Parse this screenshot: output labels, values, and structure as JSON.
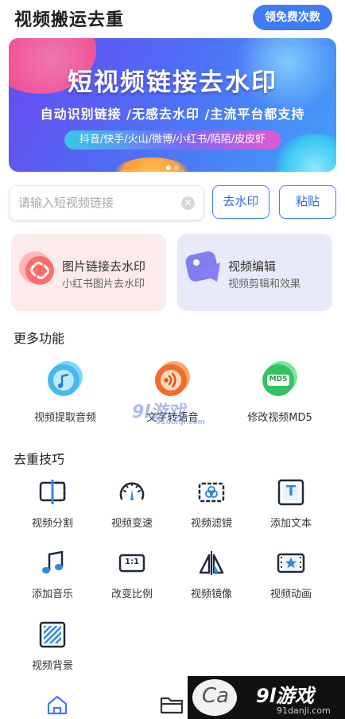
{
  "header": {
    "title": "视频搬运去重",
    "free_button": "领免费次数"
  },
  "banner": {
    "title": "短视频链接去水印",
    "subtitle": "自动识别链接 /无感去水印 /主流平台都支持",
    "platforms": "抖音/快手/火山/微博/小红书/陌陌/皮皮虾",
    "slide_count": 2,
    "active_slide": 1
  },
  "search": {
    "placeholder": "请输入短视频链接",
    "value": ""
  },
  "actions": {
    "remove_watermark": "去水印",
    "paste": "粘贴"
  },
  "cards": [
    {
      "title": "图片链接去水印",
      "subtitle": "小红书图片去水印",
      "icon": "link-icon",
      "color": "#fdeaea"
    },
    {
      "title": "视频编辑",
      "subtitle": "视频剪辑和效果",
      "icon": "video-edit-icon",
      "color": "#e9eaf9"
    }
  ],
  "more_section": {
    "title": "更多功能",
    "items": [
      {
        "label": "视频提取音频",
        "icon": "music-note-icon",
        "color": "#4fc2ef"
      },
      {
        "label": "文字转语音",
        "icon": "sound-wave-icon",
        "color": "#f7743a"
      },
      {
        "label": "修改视频MD5",
        "icon": "md5-icon",
        "color": "#33c86a",
        "badge": "MD5"
      }
    ]
  },
  "tips_section": {
    "title": "去重技巧",
    "items": [
      {
        "label": "视频分割",
        "icon": "split-icon"
      },
      {
        "label": "视频变速",
        "icon": "speedometer-icon"
      },
      {
        "label": "视频滤镜",
        "icon": "filter-icon"
      },
      {
        "label": "添加文本",
        "icon": "text-icon",
        "glyph": "T"
      },
      {
        "label": "添加音乐",
        "icon": "music-icon"
      },
      {
        "label": "改变比例",
        "icon": "ratio-icon",
        "glyph": "1:1"
      },
      {
        "label": "视频镜像",
        "icon": "mirror-icon"
      },
      {
        "label": "视频动画",
        "icon": "animation-icon"
      },
      {
        "label": "视频背景",
        "icon": "background-icon"
      }
    ]
  },
  "tabbar": {
    "tabs": [
      {
        "icon": "home-icon",
        "active": true
      },
      {
        "icon": "folder-icon",
        "active": false
      }
    ]
  },
  "watermark": {
    "logo_text": "9l游戏",
    "url": "91danji.com",
    "overlay_text": "9l游戏",
    "overlay_url": "91danji.com"
  },
  "colors": {
    "accent": "#3e7cf6",
    "icon_blue": "#2f8bde",
    "icon_dark": "#1f2a3a"
  }
}
